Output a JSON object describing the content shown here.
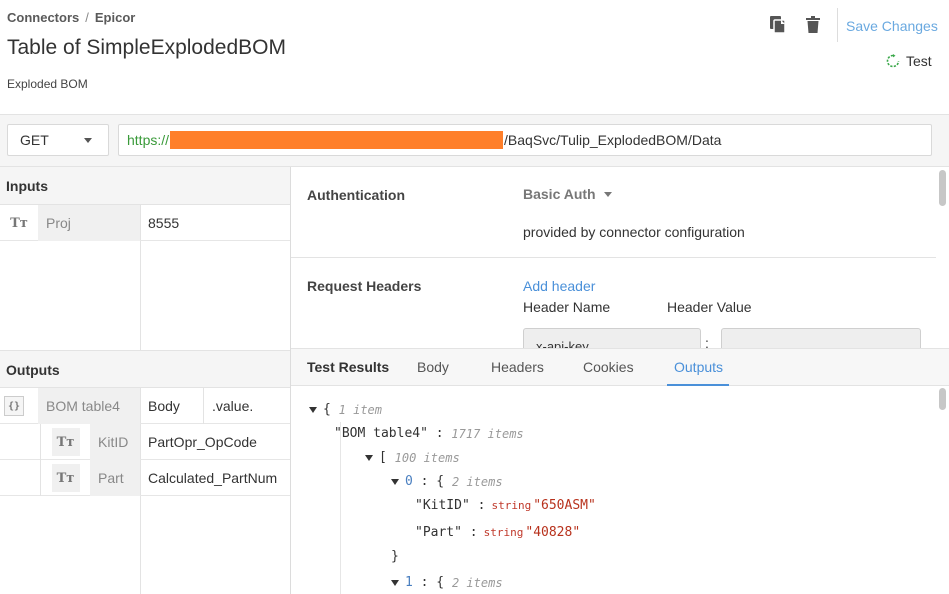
{
  "breadcrumb": {
    "parent": "Connectors",
    "separator": "/",
    "current": "Epicor"
  },
  "title": "Table of SimpleExplodedBOM",
  "subtitle": "Exploded BOM",
  "toolbar": {
    "save_label": "Save Changes",
    "test_label": "Test"
  },
  "request": {
    "method": "GET",
    "url_protocol": "https://",
    "url_path": "/BaqSvc/Tulip_ExplodedBOM/Data"
  },
  "inputs": {
    "header": "Inputs",
    "rows": [
      {
        "type_icon": "Tт",
        "name": "Proj",
        "value": "8555"
      }
    ]
  },
  "outputs": {
    "header": "Outputs",
    "table": {
      "type_icon": "{}",
      "name": "BOM table4",
      "source": "Body",
      "path": ".value."
    },
    "rows": [
      {
        "type_icon": "Tт",
        "name": "KitID",
        "value": "PartOpr_OpCode"
      },
      {
        "type_icon": "Tт",
        "name": "Part",
        "value": "Calculated_PartNum"
      }
    ]
  },
  "config": {
    "auth_label": "Authentication",
    "auth_type": "Basic Auth",
    "auth_note": "provided by connector configuration",
    "headers_label": "Request Headers",
    "add_header": "Add header",
    "col_name": "Header Name",
    "col_value": "Header Value",
    "header_name_value": "x-api-key",
    "colon": ":"
  },
  "results": {
    "tabs": [
      "Test Results",
      "Body",
      "Headers",
      "Cookies",
      "Outputs"
    ],
    "active_tab": "Outputs",
    "tree": {
      "root_brace": "{",
      "root_meta": "1 item",
      "table_key": "\"BOM table4\"",
      "table_colon": ":",
      "table_meta": "1717 items",
      "array_bracket": "[",
      "array_meta": "100 items",
      "item0_key": "0",
      "item0_brace": ": {",
      "item0_meta": "2 items",
      "f1_key": "\"KitID\"",
      "f1_colon": ":",
      "f1_type": "string",
      "f1_value": "\"650ASM\"",
      "f2_key": "\"Part\"",
      "f2_colon": ":",
      "f2_type": "string",
      "f2_value": "\"40828\"",
      "close_brace": "}",
      "item1_key": "1",
      "item1_brace": ": {",
      "item1_meta": "2 items"
    }
  },
  "colors": {
    "accent": "#4a90d9",
    "redaction": "#ff7f2a",
    "protocol": "#3a9a3a",
    "string_value": "#b8321d"
  }
}
